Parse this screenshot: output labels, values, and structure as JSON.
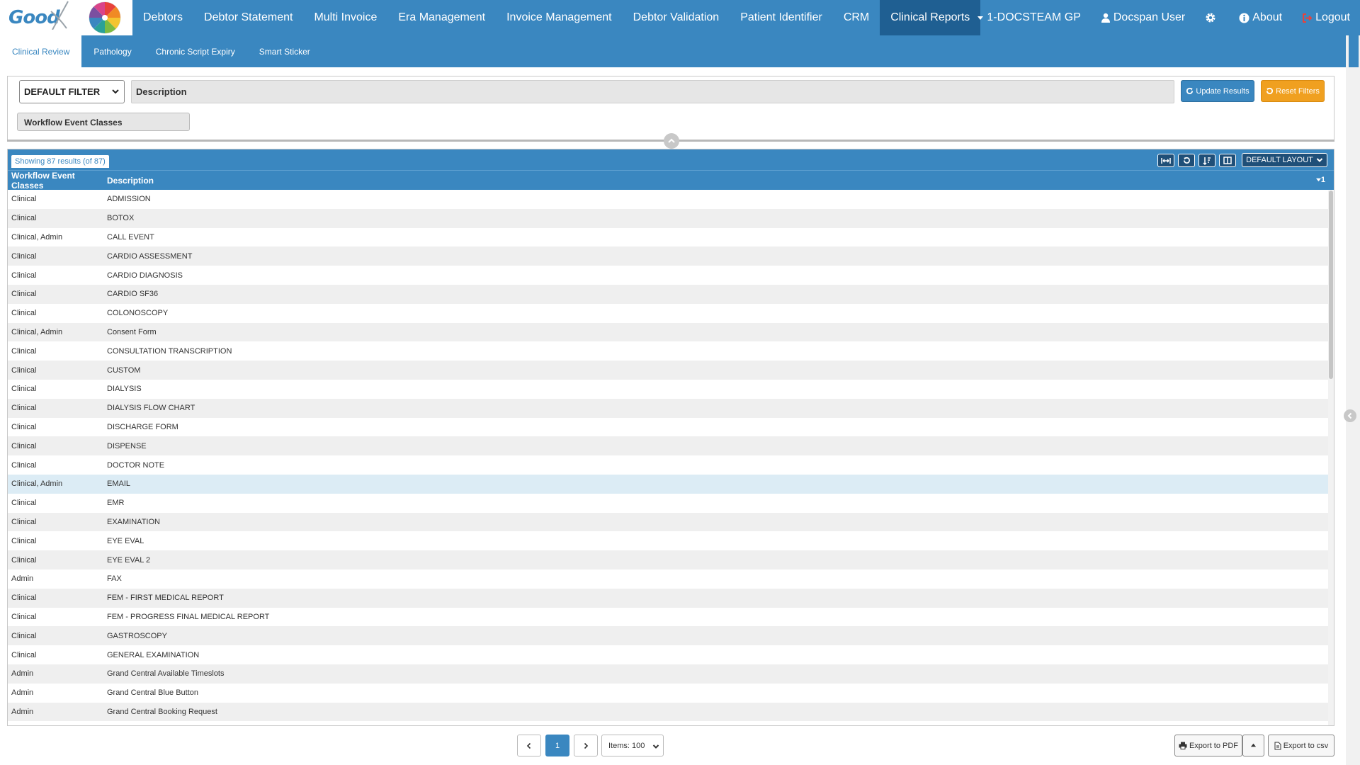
{
  "logo": {
    "text": "Good"
  },
  "nav": {
    "items": [
      {
        "label": "Debtors"
      },
      {
        "label": "Debtor Statement"
      },
      {
        "label": "Multi Invoice"
      },
      {
        "label": "Era Management"
      },
      {
        "label": "Invoice Management"
      },
      {
        "label": "Debtor Validation"
      },
      {
        "label": "Patient Identifier"
      },
      {
        "label": "CRM"
      },
      {
        "label": "Clinical Reports",
        "active": true
      }
    ],
    "right": {
      "practice": "1-DOCSTEAM GP",
      "user": "Docspan User",
      "about": "About",
      "logout": "Logout"
    }
  },
  "subtabs": [
    {
      "label": "Clinical Review",
      "active": true
    },
    {
      "label": "Pathology"
    },
    {
      "label": "Chronic Script Expiry"
    },
    {
      "label": "Smart Sticker"
    }
  ],
  "filter": {
    "selected": "DEFAULT FILTER",
    "description_label": "Description",
    "update_label": "Update Results",
    "reset_label": "Reset Filters",
    "chip_label": "Workflow Event Classes"
  },
  "grid": {
    "showing": "Showing 87 results (of 87)",
    "layout_label": "DEFAULT LAYOUT",
    "columns": [
      "Workflow Event Classes",
      "Description"
    ],
    "sort_indicator": "1",
    "rows": [
      [
        "Clinical",
        "ADMISSION"
      ],
      [
        "Clinical",
        "BOTOX"
      ],
      [
        "Clinical, Admin",
        "CALL EVENT"
      ],
      [
        "Clinical",
        "CARDIO ASSESSMENT"
      ],
      [
        "Clinical",
        "CARDIO DIAGNOSIS"
      ],
      [
        "Clinical",
        "CARDIO SF36"
      ],
      [
        "Clinical",
        "COLONOSCOPY"
      ],
      [
        "Clinical, Admin",
        "Consent Form"
      ],
      [
        "Clinical",
        "CONSULTATION TRANSCRIPTION"
      ],
      [
        "Clinical",
        "CUSTOM"
      ],
      [
        "Clinical",
        "DIALYSIS"
      ],
      [
        "Clinical",
        "DIALYSIS FLOW CHART"
      ],
      [
        "Clinical",
        "DISCHARGE FORM"
      ],
      [
        "Clinical",
        "DISPENSE"
      ],
      [
        "Clinical",
        "DOCTOR NOTE"
      ],
      [
        "Clinical, Admin",
        "EMAIL"
      ],
      [
        "Clinical",
        "EMR"
      ],
      [
        "Clinical",
        "EXAMINATION"
      ],
      [
        "Clinical",
        "EYE EVAL"
      ],
      [
        "Clinical",
        "EYE EVAL 2"
      ],
      [
        "Admin",
        "FAX"
      ],
      [
        "Clinical",
        "FEM - FIRST MEDICAL REPORT"
      ],
      [
        "Clinical",
        "FEM - PROGRESS FINAL MEDICAL REPORT"
      ],
      [
        "Clinical",
        "GASTROSCOPY"
      ],
      [
        "Clinical",
        "GENERAL EXAMINATION"
      ],
      [
        "Admin",
        "Grand Central Available Timeslots"
      ],
      [
        "Admin",
        "Grand Central Blue Button"
      ],
      [
        "Admin",
        "Grand Central Booking Request"
      ]
    ]
  },
  "pager": {
    "page": "1",
    "items_label": "Items: 100",
    "export_pdf": "Export to PDF",
    "export_csv": "Export to csv"
  },
  "colors": {
    "brand_blue": "#3a87c0",
    "active_tab": "#1f5f92",
    "reset_orange": "#f0a020",
    "logout_red": "#e8423b",
    "row_highlight": "#dcecf5"
  }
}
